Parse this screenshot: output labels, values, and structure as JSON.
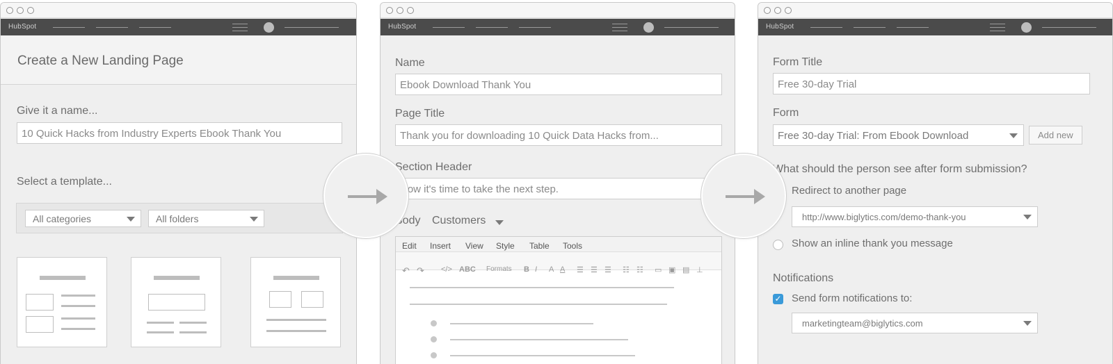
{
  "brand": {
    "logo_text": "HubSpot"
  },
  "screen1": {
    "header": "Create a New Landing Page",
    "name_label": "Give it a name...",
    "name_value": "10 Quick Hacks from Industry Experts Ebook Thank You",
    "template_label": "Select a template...",
    "categories_select": "All categories",
    "folders_select": "All folders"
  },
  "screen2": {
    "name_label": "Name",
    "name_value": "Ebook Download Thank You",
    "page_title_label": "Page Title",
    "page_title_value": "Thank you for downloading 10 Quick Data Hacks from...",
    "section_header_label": "Section Header",
    "section_header_value": "Now it's time to take the next step.",
    "body_label": "Body",
    "body_select": "Customers",
    "editor_menu": [
      "Edit",
      "Insert",
      "View",
      "Style",
      "Table",
      "Tools"
    ],
    "toolbar": {
      "code": "</>",
      "spell": "ABC",
      "formats": "Formats",
      "bold": "B",
      "italic": "I",
      "text_color": "A"
    }
  },
  "screen3": {
    "form_title_label": "Form Title",
    "form_title_value": "Free 30-day Trial",
    "form_label": "Form",
    "form_select": "Free 30-day Trial: From Ebook Download",
    "add_new": "Add new",
    "question": "What should the person see after form submission?",
    "redirect_option": "Redirect to another page",
    "redirect_url": "http://www.biglytics.com/demo-thank-you",
    "inline_option": "Show an inline thank you message",
    "notifications_label": "Notifications",
    "send_label": "Send form notifications to:",
    "send_value": "marketingteam@biglytics.com"
  },
  "colors": {
    "navbar": "#4b4b4b",
    "checkbox": "#3a9ad9",
    "window_bg": "#efefef",
    "arrow": "#a8a8a8"
  }
}
